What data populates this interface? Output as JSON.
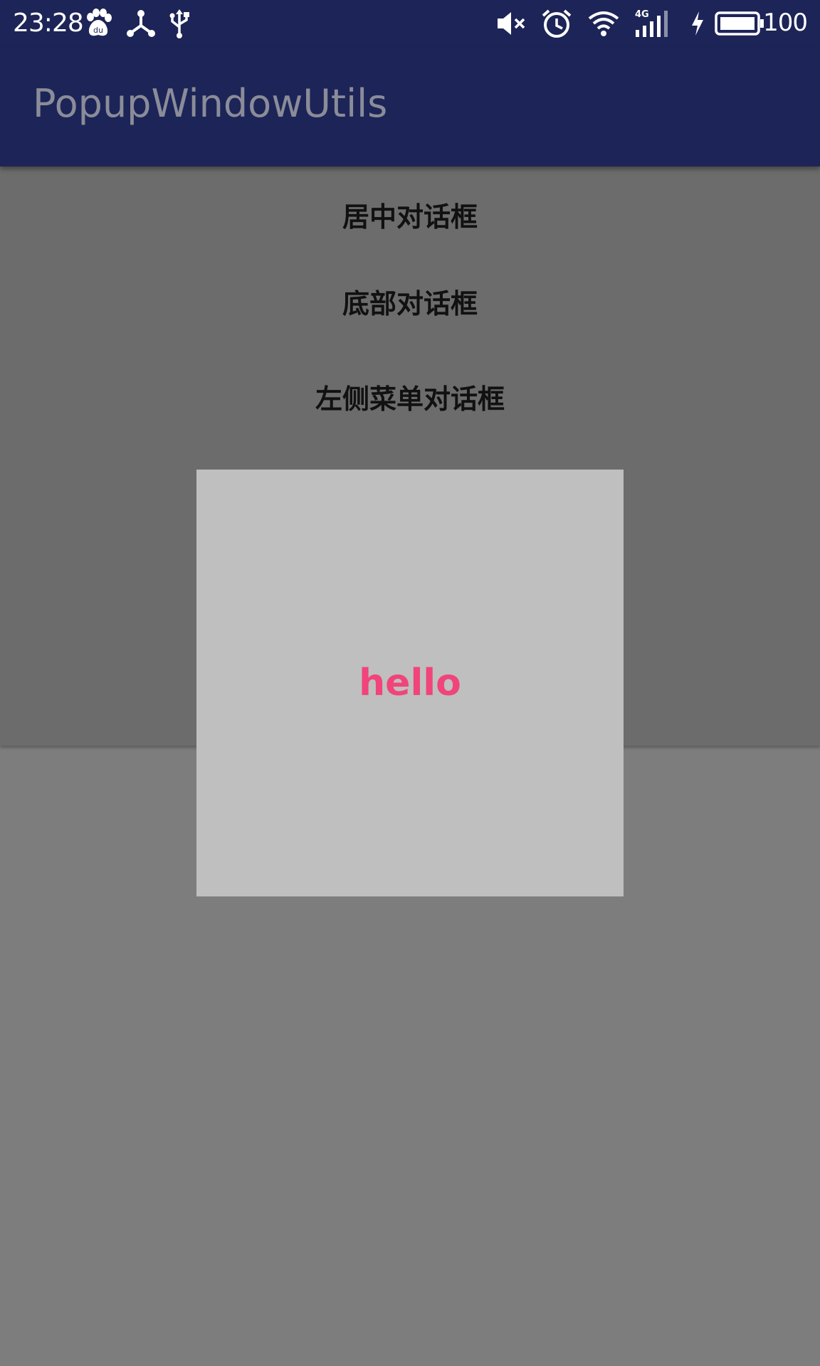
{
  "status_bar": {
    "time": "23:28",
    "battery_level": "100",
    "network_type": "4G",
    "icons": [
      "baidu-paw-icon",
      "hub-share-icon",
      "usb-icon",
      "volume-mute-icon",
      "alarm-icon",
      "wifi-icon",
      "signal-icon",
      "charging-icon",
      "battery-icon"
    ]
  },
  "app_bar": {
    "title": "PopupWindowUtils"
  },
  "menu": {
    "items": [
      {
        "label": "居中对话框"
      },
      {
        "label": "底部对话框"
      },
      {
        "label": "左侧菜单对话框"
      }
    ]
  },
  "popup": {
    "text": "hello"
  },
  "colors": {
    "status_bar_bg": "#1d2457",
    "app_bar_bg": "#1d2457",
    "title_text": "#8a8c99",
    "content_bg": "#6b6c6b",
    "overlay_bg": "#7d7d7d",
    "popup_bg": "#bfbfbf",
    "popup_text": "#f0447a"
  }
}
